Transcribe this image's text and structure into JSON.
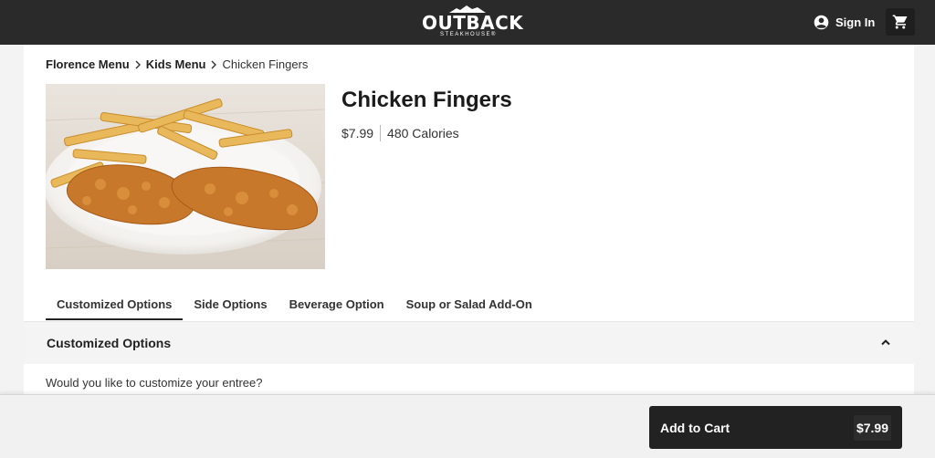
{
  "brand": {
    "name": "OUTBACK",
    "tagline": "STEAKHOUSE®"
  },
  "header": {
    "sign_in_label": "Sign In",
    "account_icon": "account-circle-icon",
    "cart_icon": "shopping-cart-icon"
  },
  "breadcrumb": {
    "items": [
      "Florence Menu",
      "Kids Menu",
      "Chicken Fingers"
    ]
  },
  "item": {
    "title": "Chicken Fingers",
    "price": "$7.99",
    "calories": "480 Calories",
    "image_alt": "Chicken Fingers with fries"
  },
  "tabs": [
    {
      "label": "Customized Options",
      "active": true
    },
    {
      "label": "Side Options",
      "active": false
    },
    {
      "label": "Beverage Option",
      "active": false
    },
    {
      "label": "Soup or Salad Add-On",
      "active": false
    }
  ],
  "section": {
    "title": "Customized Options",
    "expanded": true,
    "question": "Would you like to customize your entree?"
  },
  "add_to_cart": {
    "label": "Add to Cart",
    "price": "$7.99"
  },
  "colors": {
    "header_bg": "#2a2a2a",
    "page_bg": "#f3f3f3",
    "button_bg": "#222222"
  }
}
